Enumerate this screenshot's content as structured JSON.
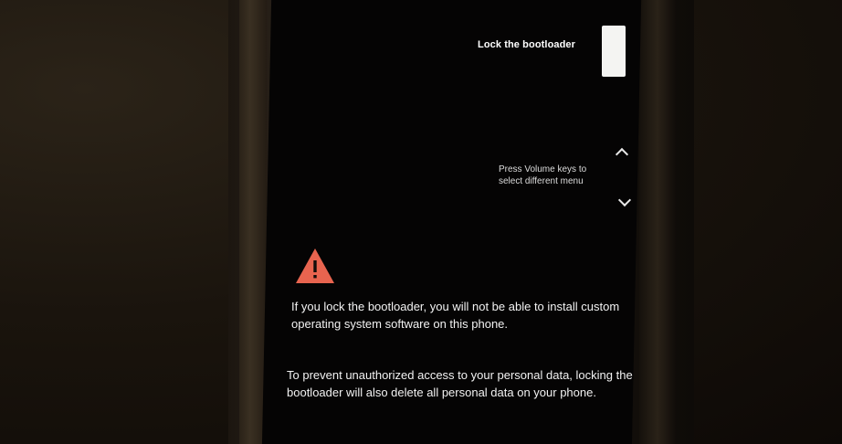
{
  "menu": {
    "selected_option": "Lock the bootloader"
  },
  "hint": {
    "line1": "Press Volume keys to",
    "line2": "select different menu"
  },
  "warning": {
    "icon": "warning-triangle-icon",
    "icon_color": "#e8644f",
    "message": "If you lock the bootloader, you will not be able to install custom operating system software on this phone."
  },
  "privacy": {
    "message": "To prevent unauthorized access to your personal data, locking the bootloader will also delete all personal data on your phone."
  }
}
